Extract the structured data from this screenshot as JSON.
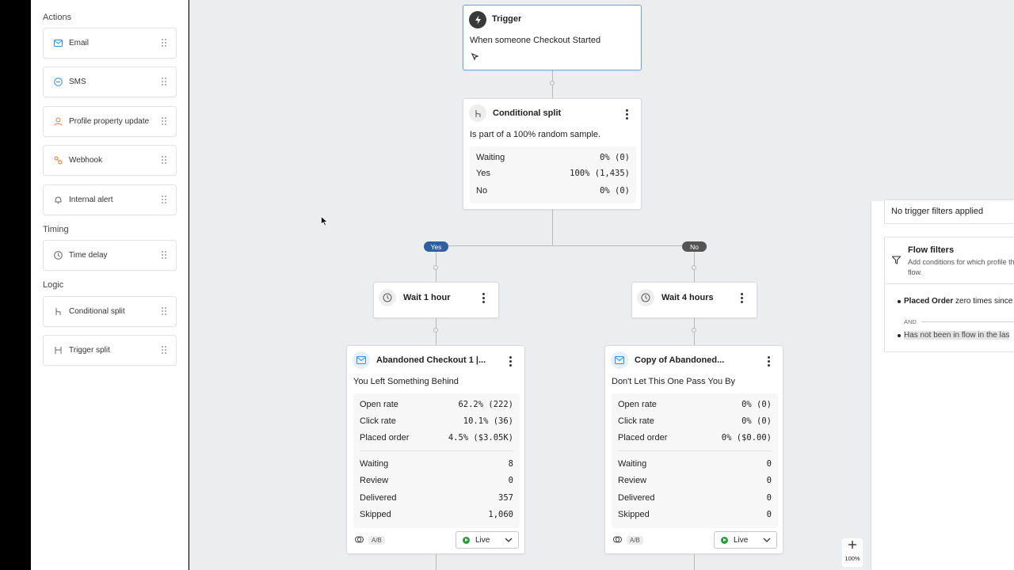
{
  "sidebar": {
    "sections": {
      "actions": "Actions",
      "timing": "Timing",
      "logic": "Logic"
    },
    "items": {
      "email": "Email",
      "sms": "SMS",
      "profile": "Profile property update",
      "webhook": "Webhook",
      "alert": "Internal alert",
      "time_delay": "Time delay",
      "conditional_split": "Conditional split",
      "trigger_split": "Trigger split"
    }
  },
  "trigger": {
    "title": "Trigger",
    "text": "When someone Checkout Started"
  },
  "split": {
    "title": "Conditional split",
    "desc": "Is part of a 100% random sample.",
    "rows": [
      {
        "label": "Waiting",
        "value": "0% (0)"
      },
      {
        "label": "Yes",
        "value": "100% (1,435)"
      },
      {
        "label": "No",
        "value": "0% (0)"
      }
    ]
  },
  "branches": {
    "yes": "Yes",
    "no": "No"
  },
  "wait_left": {
    "title": "Wait 1 hour"
  },
  "wait_right": {
    "title": "Wait 4 hours"
  },
  "email_left": {
    "title": "Abandoned Checkout 1 |...",
    "subject": "You Left Something Behind",
    "metrics": [
      {
        "label": "Open rate",
        "value": "62.2% (222)"
      },
      {
        "label": "Click rate",
        "value": "10.1% (36)"
      },
      {
        "label": "Placed order",
        "value": "4.5% ($3.05K)"
      }
    ],
    "counts": [
      {
        "label": "Waiting",
        "value": "8"
      },
      {
        "label": "Review",
        "value": "0"
      },
      {
        "label": "Delivered",
        "value": "357"
      },
      {
        "label": "Skipped",
        "value": "1,060"
      }
    ],
    "ab": "A/B",
    "status": "Live"
  },
  "email_right": {
    "title": "Copy of Abandoned...",
    "subject": "Don't Let This One Pass You By",
    "metrics": [
      {
        "label": "Open rate",
        "value": "0% (0)"
      },
      {
        "label": "Click rate",
        "value": "0% (0)"
      },
      {
        "label": "Placed order",
        "value": "0% ($0.00)"
      }
    ],
    "counts": [
      {
        "label": "Waiting",
        "value": "0"
      },
      {
        "label": "Review",
        "value": "0"
      },
      {
        "label": "Delivered",
        "value": "0"
      },
      {
        "label": "Skipped",
        "value": "0"
      }
    ],
    "ab": "A/B",
    "status": "Live"
  },
  "right_panel": {
    "no_filters": "No trigger filters applied",
    "flow_filters_title": "Flow filters",
    "flow_filters_desc": "Add conditions for which profile the flow.",
    "cond1_bold": "Placed Order",
    "cond1_rest": " zero times since",
    "and": "AND",
    "cond2_a": "Has not been in flow",
    "cond2_b": " in the las"
  },
  "zoom": {
    "level": "100%"
  },
  "colors": {
    "canvas": "#ecedef",
    "accent": "#4a90d9",
    "live": "#2b9a3e",
    "yes_pill": "#2f5f9e",
    "no_pill": "#555555"
  }
}
